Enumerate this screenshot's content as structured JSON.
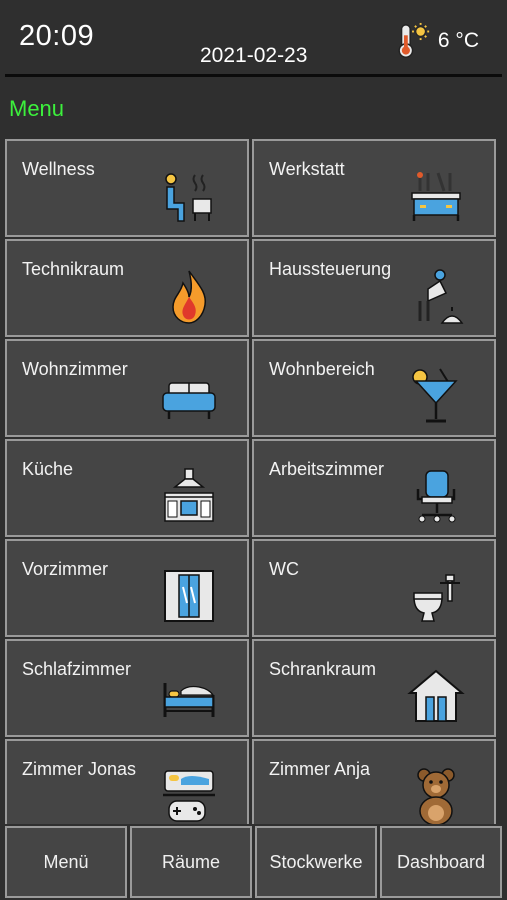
{
  "status_bar": {
    "time": "20:09",
    "date": "2021-02-23",
    "temperature": "6 °C",
    "weather_icon": "thermometer-sun-icon"
  },
  "menu": {
    "heading": "Menu",
    "heading_color": "#3cf03c"
  },
  "tiles": [
    {
      "label": "Wellness",
      "icon": "sauna-icon"
    },
    {
      "label": "Werkstatt",
      "icon": "workbench-icon"
    },
    {
      "label": "Technikraum",
      "icon": "flame-icon"
    },
    {
      "label": "Haussteuerung",
      "icon": "lamp-person-icon"
    },
    {
      "label": "Wohnzimmer",
      "icon": "sofa-icon"
    },
    {
      "label": "Wohnbereich",
      "icon": "cocktail-icon"
    },
    {
      "label": "Küche",
      "icon": "kitchen-icon"
    },
    {
      "label": "Arbeitszimmer",
      "icon": "office-chair-icon"
    },
    {
      "label": "Vorzimmer",
      "icon": "wardrobe-icon"
    },
    {
      "label": "WC",
      "icon": "toilet-icon"
    },
    {
      "label": "Schlafzimmer",
      "icon": "bed-icon"
    },
    {
      "label": "Schrankraum",
      "icon": "house-icon"
    },
    {
      "label": "Zimmer Jonas",
      "icon": "kid-bed-gamepad-icon"
    },
    {
      "label": "Zimmer Anja",
      "icon": "teddy-bear-icon"
    }
  ],
  "tabbar": {
    "tabs": [
      "Menü",
      "Räume",
      "Stockwerke",
      "Dashboard"
    ]
  }
}
